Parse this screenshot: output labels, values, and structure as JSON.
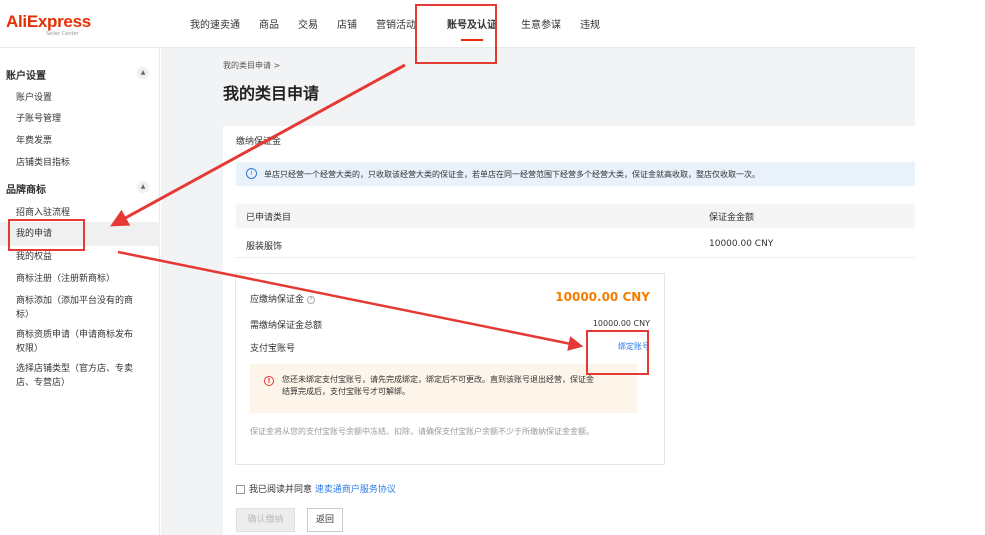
{
  "app": {
    "logo": "AliExpress",
    "logo_sub": "Seller Center"
  },
  "nav": {
    "items": [
      "我的速卖通",
      "商品",
      "交易",
      "店铺",
      "营销活动",
      "账号及认证",
      "生意参谋",
      "违规"
    ]
  },
  "sidebar": {
    "group1": "账户设置",
    "group1_items": [
      "账户设置",
      "子账号管理",
      "年费发票",
      "店铺类目指标"
    ],
    "group2": "品牌商标",
    "group2_items": [
      "招商入驻流程",
      "我的申请",
      "我的权益",
      "商标注册（注册新商标）",
      "商标添加（添加平台没有的商标）",
      "商标资质申请（申请商标发布权限）",
      "选择店铺类型（官方店、专卖店、专营店）"
    ],
    "toggle_icon": "chevron-up-icon"
  },
  "main": {
    "breadcrumb": "我的类目申请  >",
    "title": "我的类目申请",
    "section_title": "缴纳保证金",
    "info_text": "单店只经营一个经营大类的，只收取该经营大类的保证金，若单店在同一经营范围下经营多个经营大类，保证金就高收取，整店仅收取一次。",
    "table": {
      "headers": [
        "已申请类目",
        "保证金金额"
      ],
      "rows": [
        [
          "服装服饰",
          "10000.00  CNY"
        ]
      ]
    },
    "deposit": {
      "due_label": "应缴纳保证金",
      "due_amount": "10000.00 CNY",
      "total_label": "需缴纳保证金总额",
      "total_amount": "10000.00 CNY",
      "alipay_label": "支付宝账号",
      "bind_link": "绑定账号",
      "warning": "您还未绑定支付宝账号，请先完成绑定，绑定后不可更改。直到该账号退出经营，保证金结算完成后，支付宝账号才可解绑。",
      "note": "保证金将从您的支付宝账号余额中冻结、扣除，请确保支付宝账户余额不少于所缴纳保证金金额。"
    },
    "agree_text": "我已阅读并同意",
    "agree_link": "速卖通商户服务协议",
    "confirm_button": "确认缴纳",
    "back_button": "返回"
  },
  "colors": {
    "brand": "#e62e04",
    "link": "#2d7be5",
    "amount": "#f57c00",
    "annotation": "#e53935"
  }
}
